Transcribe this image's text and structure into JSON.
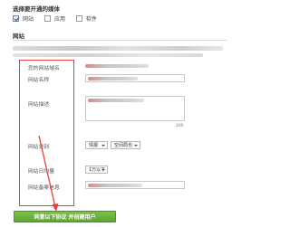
{
  "media": {
    "title": "选择要开通的媒体",
    "options": [
      {
        "label": "网站",
        "checked": true
      },
      {
        "label": "应用",
        "checked": false
      },
      {
        "label": "软件",
        "checked": false
      }
    ]
  },
  "section": {
    "title": "网站"
  },
  "form": {
    "site_name_label": "您的网站域名",
    "site_title_label": "网站名称",
    "description_label": "网站描述",
    "description_counter": "200",
    "category_label": "网站类别",
    "category_select_1": "情报",
    "category_select_2": "空间局也",
    "traffic_label": "网站日均量",
    "traffic_select": "1万以下",
    "icp_label": "网站备案信息"
  },
  "submit_button": {
    "label": "同意以下协议  并创建用户"
  },
  "colors": {
    "highlight": "#e8403a",
    "button": "#6ab33b",
    "arrow": "#e8403a"
  }
}
